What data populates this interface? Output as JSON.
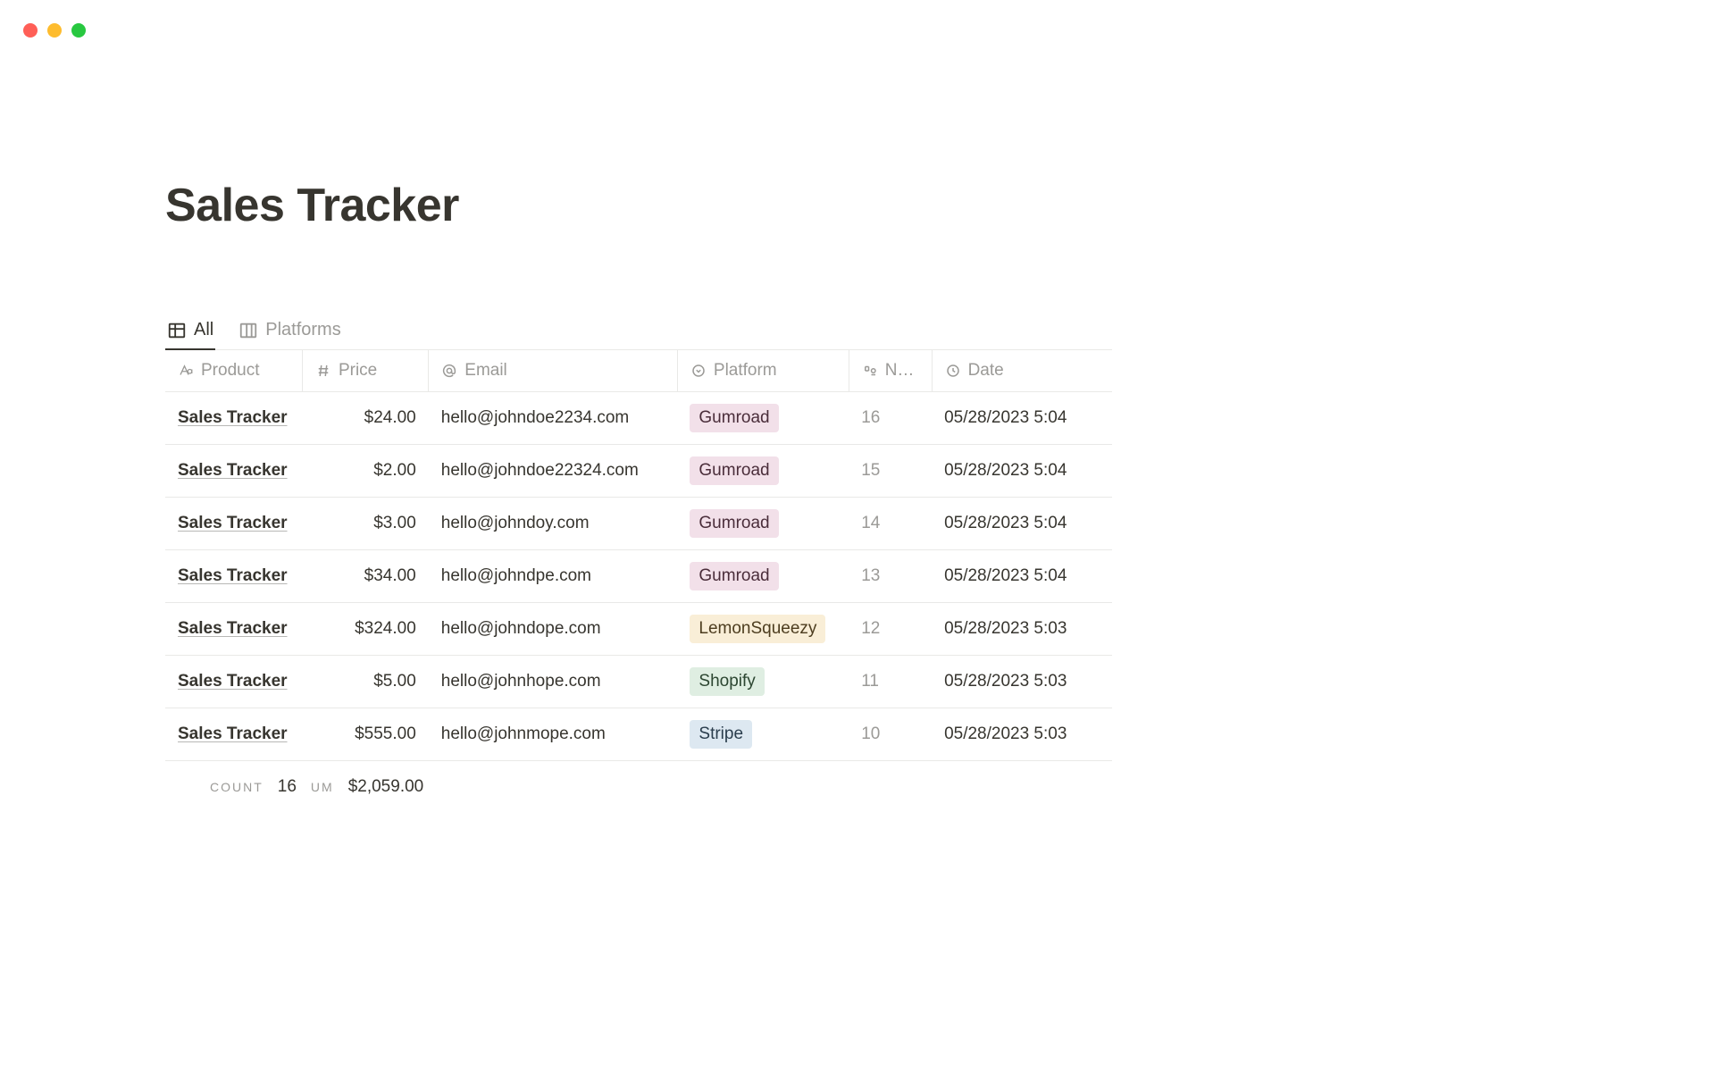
{
  "title": "Sales Tracker",
  "tabs": [
    {
      "label": "All",
      "active": true,
      "icon": "table"
    },
    {
      "label": "Platforms",
      "active": false,
      "icon": "board"
    }
  ],
  "columns": {
    "product": "Product",
    "price": "Price",
    "email": "Email",
    "platform": "Platform",
    "num": "N…",
    "date": "Date"
  },
  "rows": [
    {
      "product": "Sales Tracker",
      "price": "$24.00",
      "email": "hello@johndoe2234.com",
      "platform": "Gumroad",
      "platform_class": "gumroad",
      "num": "16",
      "date": "05/28/2023 5:04"
    },
    {
      "product": "Sales Tracker",
      "price": "$2.00",
      "email": "hello@johndoe22324.com",
      "platform": "Gumroad",
      "platform_class": "gumroad",
      "num": "15",
      "date": "05/28/2023 5:04"
    },
    {
      "product": "Sales Tracker",
      "price": "$3.00",
      "email": "hello@johndoy.com",
      "platform": "Gumroad",
      "platform_class": "gumroad",
      "num": "14",
      "date": "05/28/2023 5:04"
    },
    {
      "product": "Sales Tracker",
      "price": "$34.00",
      "email": "hello@johndpe.com",
      "platform": "Gumroad",
      "platform_class": "gumroad",
      "num": "13",
      "date": "05/28/2023 5:04"
    },
    {
      "product": "Sales Tracker",
      "price": "$324.00",
      "email": "hello@johndope.com",
      "platform": "LemonSqueezy",
      "platform_class": "lemonsqueezy",
      "num": "12",
      "date": "05/28/2023 5:03"
    },
    {
      "product": "Sales Tracker",
      "price": "$5.00",
      "email": "hello@johnhope.com",
      "platform": "Shopify",
      "platform_class": "shopify",
      "num": "11",
      "date": "05/28/2023 5:03"
    },
    {
      "product": "Sales Tracker",
      "price": "$555.00",
      "email": "hello@johnmope.com",
      "platform": "Stripe",
      "platform_class": "stripe",
      "num": "10",
      "date": "05/28/2023 5:03"
    }
  ],
  "footer": {
    "count_label": "COUNT",
    "count_value": "16",
    "sum_label": "UM",
    "sum_value": "$2,059.00"
  }
}
